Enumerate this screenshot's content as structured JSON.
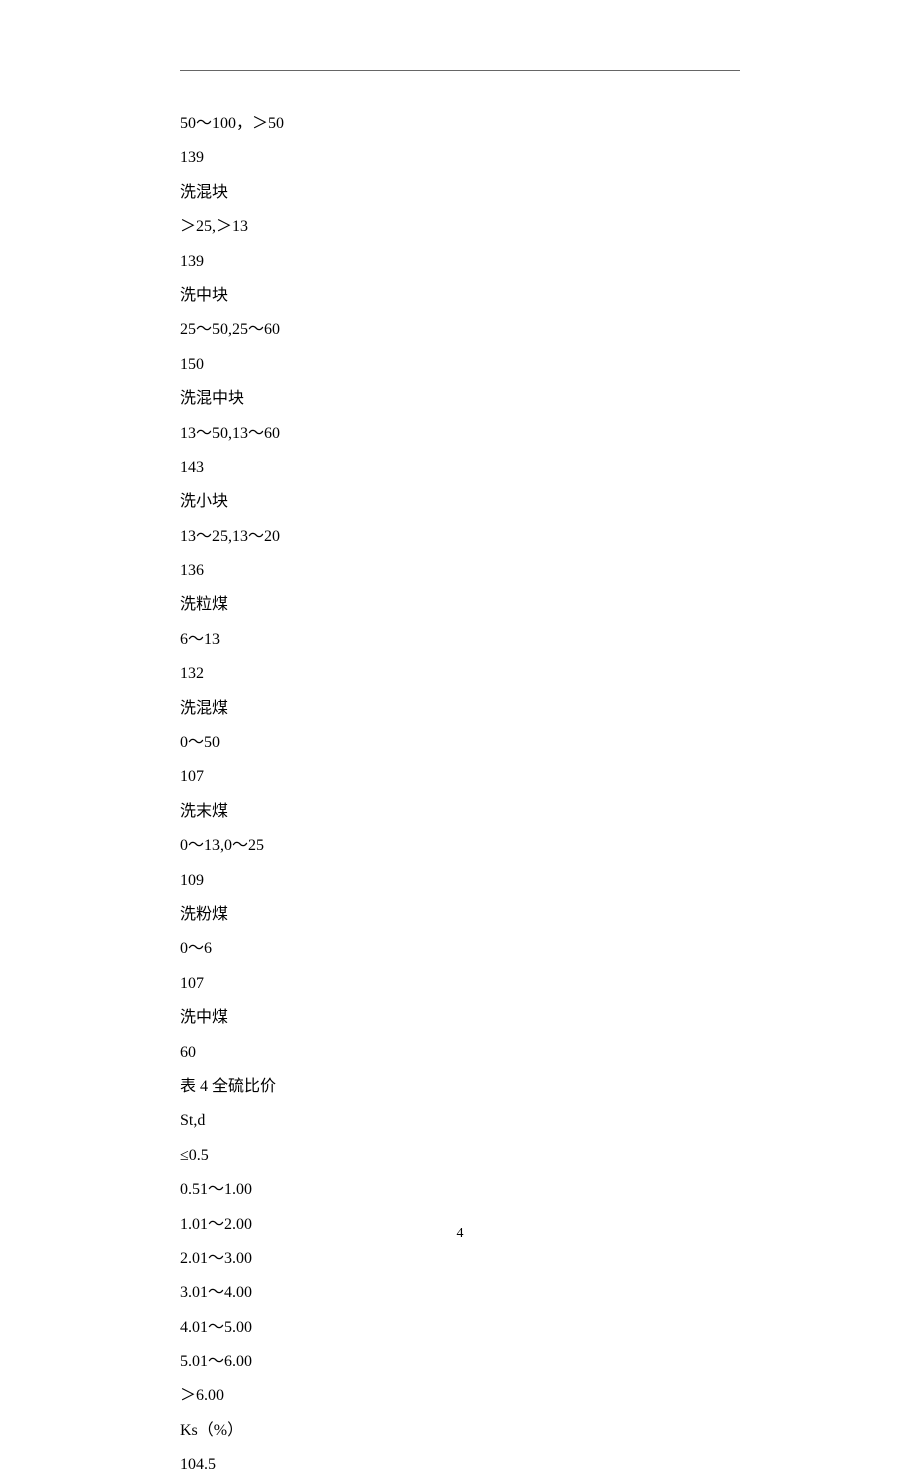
{
  "lines": [
    "50～100，＞50",
    "139",
    "洗混块",
    "＞25,＞13",
    "139",
    "洗中块",
    "25～50,25～60",
    "150",
    "洗混中块",
    "13～50,13～60",
    "143",
    "洗小块",
    "13～25,13～20",
    "136",
    "洗粒煤",
    "6～13",
    "132",
    "洗混煤",
    "0～50",
    "107",
    "洗末煤",
    "0～13,0～25",
    "109",
    "洗粉煤",
    "0～6",
    "107",
    "洗中煤",
    "60",
    "表 4 全硫比价",
    "St,d",
    "≤0.5",
    "0.51～1.00",
    "1.01～2.00",
    "2.01～3.00",
    "3.01～4.00",
    "4.01～5.00",
    "5.01～6.00",
    "＞6.00",
    "Ks（%）",
    "104.5"
  ],
  "page_number": "4"
}
